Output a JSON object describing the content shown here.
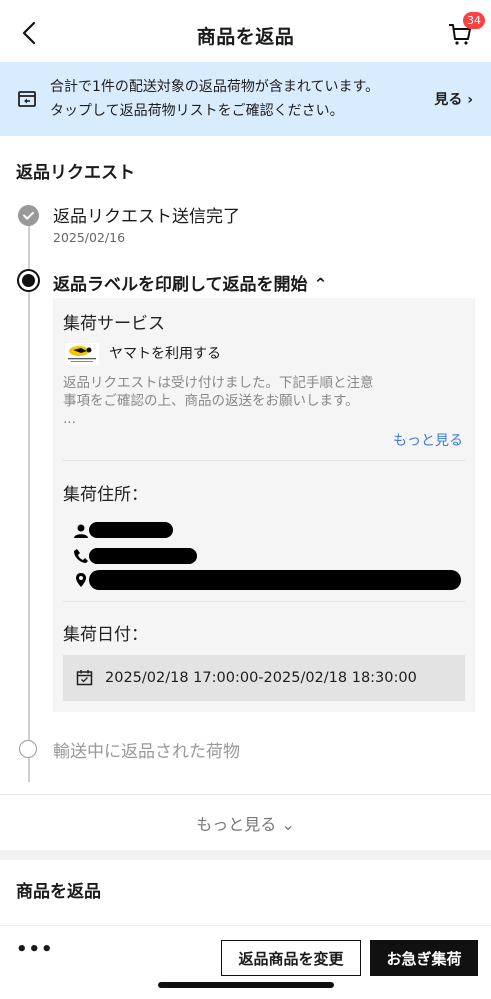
{
  "header": {
    "title": "商品を返品",
    "cart_count": "34"
  },
  "banner": {
    "line1": "合計で1件の配送対象の返品荷物が含まれています。",
    "line2": "タップして返品荷物リストをご確認ください。",
    "link_label": "見る ›"
  },
  "return_request": {
    "section_title": "返品リクエスト",
    "steps": [
      {
        "title": "返品リクエスト送信完了",
        "date": "2025/02/16",
        "status": "done"
      },
      {
        "title": "返品ラベルを印刷して返品を開始 ⌃",
        "status": "active"
      },
      {
        "title": "輸送中に返品された荷物",
        "status": "pending"
      }
    ],
    "card": {
      "pickup_service_heading": "集荷サービス",
      "carrier_label": "ヤマトを利用する",
      "carrier_logo_text": "YAMATO TRANSPORT",
      "description": "返品リクエストは受け付けました。下記手順と注意事項をご確認の上、商品の返送をお願いします。",
      "description_ellipsis": "...",
      "more_label": "もっと見る",
      "address_heading": "集荷住所：",
      "date_heading": "集荷日付：",
      "pickup_datetime": "2025/02/18 17:00:00-2025/02/18 18:30:00"
    },
    "show_more_label": "もっと見る ⌄"
  },
  "section2": {
    "title": "商品を返品"
  },
  "bottom_bar": {
    "more_label": "•••",
    "change_button": "返品商品を変更",
    "urgent_button": "お急ぎ集荷"
  }
}
